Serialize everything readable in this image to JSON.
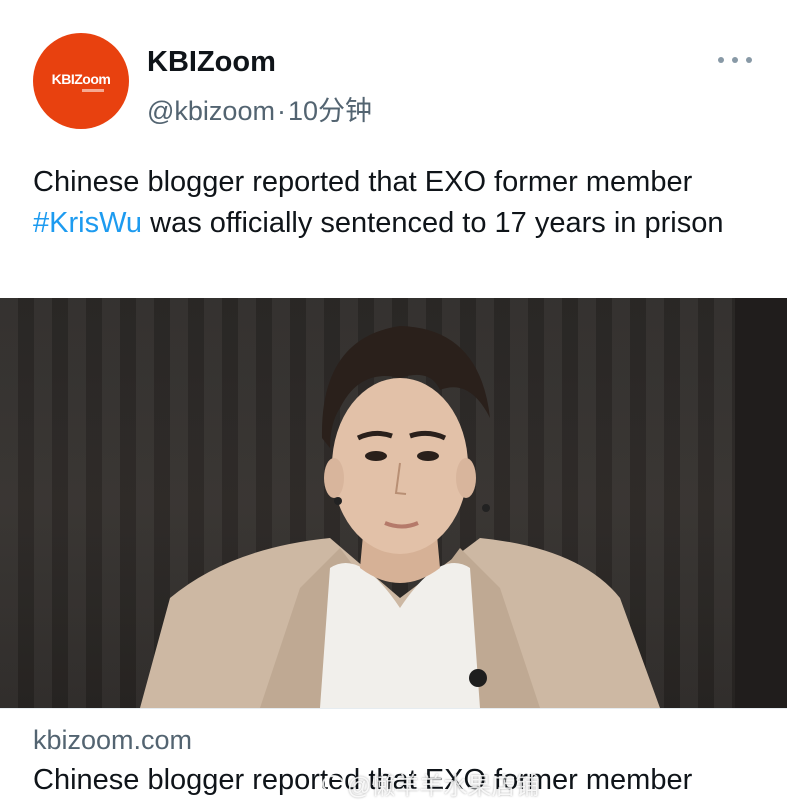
{
  "tweet": {
    "avatar_logo": "KBIZoom",
    "display_name": "KBIZoom",
    "handle": "@kbizoom",
    "separator": "·",
    "time": "10分钟",
    "text_part1": "Chinese blogger reported that EXO former member ",
    "hashtag": "#KrisWu",
    "text_part2": " was officially sentenced to 17 years in prison",
    "more_icon": "more-dots-icon"
  },
  "card": {
    "domain": "kbizoom.com",
    "title": "Chinese blogger reported that EXO former member"
  },
  "watermark": {
    "text": "@懒羊羊水果店铺",
    "icon": "weibo-icon"
  },
  "colors": {
    "avatar_bg": "#e8410f",
    "hashtag": "#1d9bf0",
    "secondary_text": "#536471"
  }
}
